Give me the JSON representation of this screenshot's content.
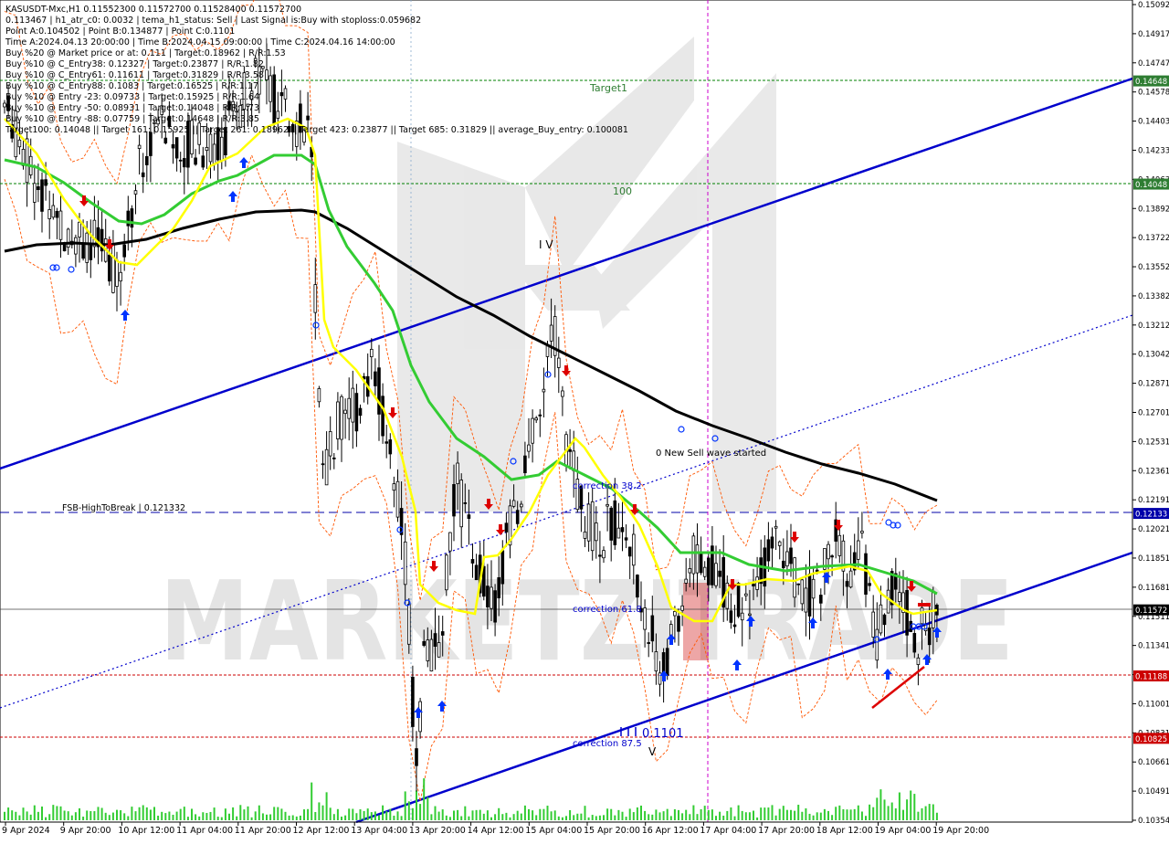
{
  "header": {
    "lines": [
      "KASUSDT-Mxc,H1  0.11552300 0.11572700 0.11528400 0.11572700",
      "0.113467 | h1_atr_c0: 0.0032 | tema_h1_status: Sell | Last Signal is:Buy with stoploss:0.059682",
      "Point A:0.104502 | Point B:0.134877 | Point C:0.1101",
      "Time A:2024.04.13 20:00:00 | Time B:2024.04.15 09:00:00 | Time C:2024.04.16 14:00:00",
      "Buy %20 @ Market price or at: 0.111 | Target:0.18962 | R/R:1.53",
      "Buy %10 @ C_Entry38: 0.12327 | Target:0.23877 | R/R:1.82",
      "Buy %10 @ C_Entry61: 0.11611 | Target:0.31829 | R/R:3.58",
      "Buy %10 @ C_Entry88: 0.1083 | Target:0.16525 | R/R:1.17",
      "Buy %10 @ Entry -23: 0.09733 | Target:0.15925 | R/R:1.64",
      "Buy %10 @ Entry -50: 0.08931 | Target:0.14048 | R/R:1.73",
      "Buy %10 @ Entry -88: 0.07759 | Target:0.14648 | R/R:3.85",
      "Target100: 0.14048 || Target 161: 0.15925 || Target 261: 0.18962 || Target 423: 0.23877 || Target 685: 0.31829 || average_Buy_entry: 0.100081"
    ]
  },
  "annotations": {
    "target1": "Target1",
    "level100": "100",
    "fsb": "FSB-HighToBreak | 0.121332",
    "sell_wave": "0 New Sell wave started",
    "corr382": "correction 38.2",
    "corr618": "correction 61.8",
    "corr875": "correction 87.5",
    "wave_iv": "I V",
    "wave_v": "V",
    "point_c": "0.1101",
    "watermark": "MARKETZITRADE"
  },
  "colors": {
    "channel": "#0000cc",
    "ma_black": "#000000",
    "ma_green": "#33cc33",
    "ma_yellow": "#ffff00",
    "envelope": "#ff5500",
    "target_line": "#008000",
    "fsb_line": "#0000aa",
    "stop_line": "#cc0000",
    "vertical_marker": "#cc00cc",
    "buy_arrow": "#0033ff",
    "sell_arrow": "#dd0000",
    "volume": "#33cc33",
    "price_tag": "#000000"
  },
  "chart_data": {
    "type": "candlestick",
    "symbol": "KASUSDT-Mxc,H1",
    "ylim": [
      0.10354,
      0.15092
    ],
    "y_ticks": [
      "0.15092",
      "0.14917",
      "0.14747",
      "0.14578",
      "0.14403",
      "0.14233",
      "0.14063",
      "0.13892",
      "0.13722",
      "0.13552",
      "0.13382",
      "0.13212",
      "0.13042",
      "0.12871",
      "0.12701",
      "0.12531",
      "0.12361",
      "0.12191",
      "0.12021",
      "0.11851",
      "0.11681",
      "0.11511",
      "0.11341",
      "0.11171",
      "0.11001",
      "0.10831",
      "0.10661",
      "0.10491",
      "0.10354"
    ],
    "x_labels": [
      "9 Apr 2024",
      "9 Apr 20:00",
      "10 Apr 12:00",
      "11 Apr 04:00",
      "11 Apr 20:00",
      "12 Apr 12:00",
      "13 Apr 04:00",
      "13 Apr 20:00",
      "14 Apr 12:00",
      "15 Apr 04:00",
      "15 Apr 20:00",
      "16 Apr 12:00",
      "17 Apr 04:00",
      "17 Apr 20:00",
      "18 Apr 12:00",
      "19 Apr 04:00",
      "19 Apr 20:00"
    ],
    "levels": [
      {
        "name": "Target1",
        "value": 0.14648,
        "tag": "0.14648"
      },
      {
        "name": "100",
        "value": 0.14048,
        "tag": "0.14048"
      },
      {
        "name": "FSB-HighToBreak",
        "value": 0.12133,
        "tag": "0.12133"
      },
      {
        "name": "current",
        "value": 0.11572,
        "tag": "0.11572"
      },
      {
        "name": "stop1",
        "value": 0.11188,
        "tag": "0.11188"
      },
      {
        "name": "stop2",
        "value": 0.10825,
        "tag": "0.10825"
      }
    ],
    "last_price": 0.115727
  }
}
